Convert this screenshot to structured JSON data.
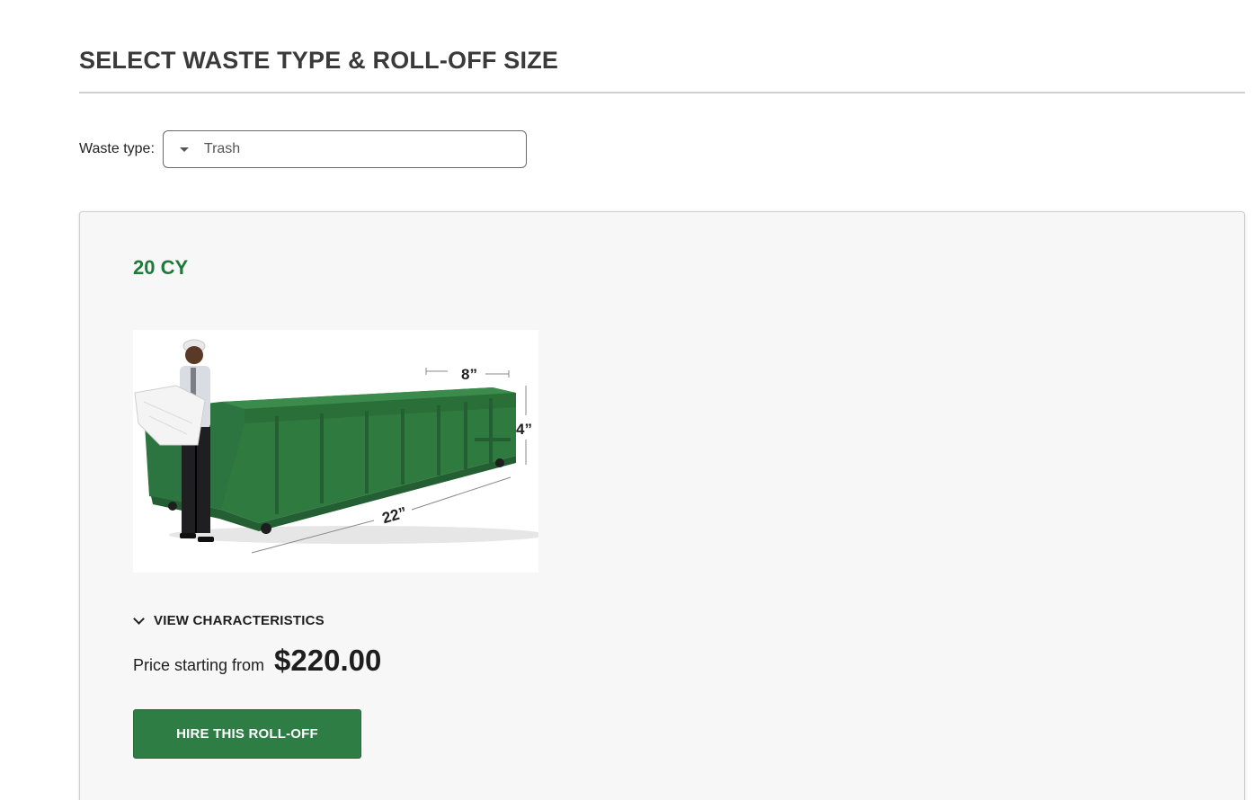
{
  "section": {
    "title": "SELECT WASTE TYPE & ROLL-OFF SIZE"
  },
  "waste_type": {
    "label": "Waste type:",
    "selected": "Trash",
    "caret_icon": "caret-down-icon"
  },
  "card": {
    "size_title": "20 CY",
    "image": {
      "dimension_width": "8”",
      "dimension_height": "4”",
      "dimension_length": "22”"
    },
    "view_characteristics_label": "VIEW CHARACTERISTICS",
    "price_label": "Price starting from",
    "price_value": "$220.00",
    "hire_button_label": "HIRE THIS ROLL-OFF"
  },
  "colors": {
    "accent_green": "#2e7d45",
    "size_title_green": "#1f7a3a",
    "card_background": "#f7f7f7",
    "dumpster_green": "#2f7a3f"
  }
}
